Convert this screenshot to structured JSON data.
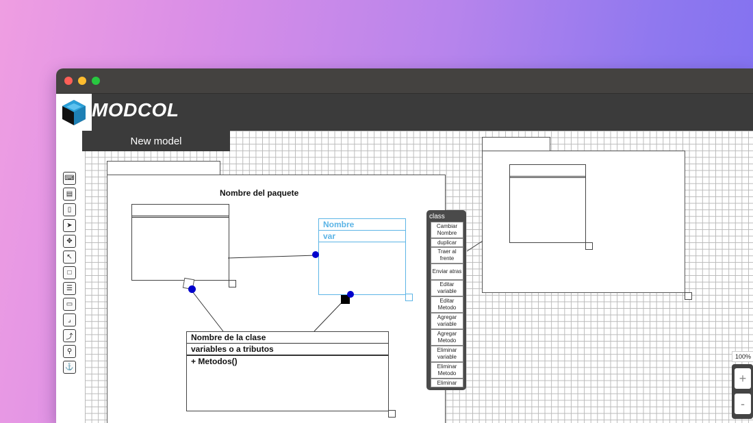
{
  "app": {
    "title": "MODCOL",
    "logo": "modcol-cube-logo"
  },
  "model_tab": {
    "label": "New model"
  },
  "toolbar": {
    "icons": [
      "keyboard-icon",
      "save-icon",
      "new-file-icon",
      "pointer-icon",
      "move-icon",
      "select-area-icon",
      "class-box-icon",
      "list-box-icon",
      "window-box-icon",
      "corner-icon",
      "arrow-up-icon",
      "pin-icon",
      "anchor-icon"
    ]
  },
  "package": {
    "name": "Nombre del paquete"
  },
  "classes": {
    "selected": {
      "name": "Nombre",
      "var": "var"
    },
    "main": {
      "name": "Nombre de la clase",
      "attributes": "variables o a tributos",
      "methods": "+ Metodos()"
    }
  },
  "context_menu": {
    "title": "class",
    "items": [
      "Cambiar Nombre",
      "duplicar",
      "Traer al frente",
      "Enviar atras",
      "Editar variable",
      "Editar Metodo",
      "Agregar variable",
      "Agregar Metodo",
      "Eliminar variable",
      "Eliminar Metodo",
      "Eliminar"
    ]
  },
  "zoom": {
    "level": "100%",
    "plus": "+",
    "minus": "-"
  },
  "colors": {
    "selected_class": "#5bb4e6",
    "connector_dot": "#0000cc",
    "appbar": "#3b3b3b"
  }
}
